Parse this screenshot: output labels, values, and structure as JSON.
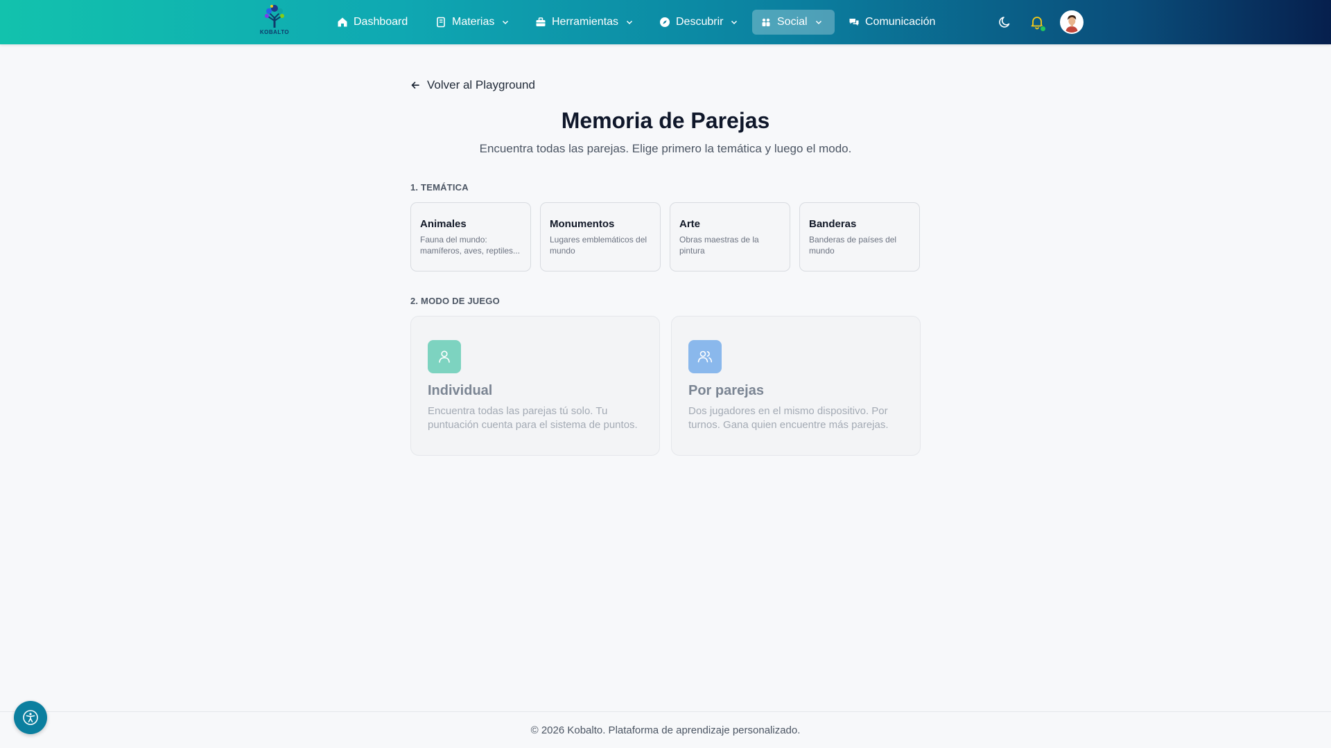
{
  "navbar": {
    "logo_text": "KOBALTO",
    "items": [
      {
        "label": "Dashboard",
        "icon": "home-icon",
        "dropdown": false,
        "active": false
      },
      {
        "label": "Materias",
        "icon": "book-icon",
        "dropdown": true,
        "active": false
      },
      {
        "label": "Herramientas",
        "icon": "toolbox-icon",
        "dropdown": true,
        "active": false
      },
      {
        "label": "Descubrir",
        "icon": "compass-icon",
        "dropdown": true,
        "active": false
      },
      {
        "label": "Social",
        "icon": "group-icon",
        "dropdown": true,
        "active": true
      },
      {
        "label": "Comunicación",
        "icon": "chat-icon",
        "dropdown": false,
        "active": false
      }
    ],
    "right_icons": [
      "moon-icon",
      "bell-icon",
      "avatar"
    ],
    "notification_status_color": "#22c55e"
  },
  "main": {
    "back_label": "Volver al Playground",
    "title": "Memoria de Parejas",
    "subtitle": "Encuentra todas las parejas. Elige primero la temática y luego el modo.",
    "theme_section_label": "1. TEMÁTICA",
    "themes": [
      {
        "title": "Animales",
        "desc": "Fauna del mundo: mamíferos, aves, reptiles..."
      },
      {
        "title": "Monumentos",
        "desc": "Lugares emblemáticos del mundo"
      },
      {
        "title": "Arte",
        "desc": "Obras maestras de la pintura"
      },
      {
        "title": "Banderas",
        "desc": "Banderas de países del mundo"
      }
    ],
    "mode_section_label": "2. MODO DE JUEGO",
    "modes": [
      {
        "title": "Individual",
        "desc": "Encuentra todas las parejas tú solo. Tu puntuación cuenta para el sistema de puntos.",
        "icon": "user-icon",
        "color": "#7dd3c0"
      },
      {
        "title": "Por parejas",
        "desc": "Dos jugadores en el mismo dispositivo. Por turnos. Gana quien encuentre más parejas.",
        "icon": "users-icon",
        "color": "#8ab8ec"
      }
    ]
  },
  "footer": {
    "text": "© 2026 Kobalto. Plataforma de aprendizaje personalizado."
  },
  "colors": {
    "accent": "#0b7f9f",
    "nav_gradient_start": "#12c2ad",
    "nav_gradient_end": "#061f4d"
  }
}
